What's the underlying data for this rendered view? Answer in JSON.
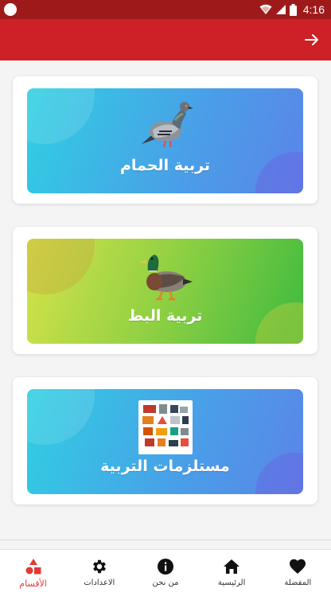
{
  "status_bar": {
    "time": "4:16",
    "icons": [
      "notification-dot-icon",
      "wifi-icon",
      "signal-icon",
      "battery-icon"
    ]
  },
  "app_bar": {
    "color": "#cd2027",
    "back_icon": "arrow-icon"
  },
  "categories": [
    {
      "label": "تربية الحمام",
      "image": "pigeon-image"
    },
    {
      "label": "تربية البط",
      "image": "duck-image"
    },
    {
      "label": "مستلزمات التربية",
      "image": "supplies-image"
    }
  ],
  "bottom_nav": {
    "items": [
      {
        "label": "الأقسام",
        "icon": "categories-icon",
        "active": true
      },
      {
        "label": "الاعدادات",
        "icon": "gear-icon",
        "active": false
      },
      {
        "label": "من نحن",
        "icon": "info-icon",
        "active": false
      },
      {
        "label": "الرئيسية",
        "icon": "home-icon",
        "active": false
      },
      {
        "label": "المفضلة",
        "icon": "heart-icon",
        "active": false
      }
    ],
    "active_color": "#e53935"
  }
}
